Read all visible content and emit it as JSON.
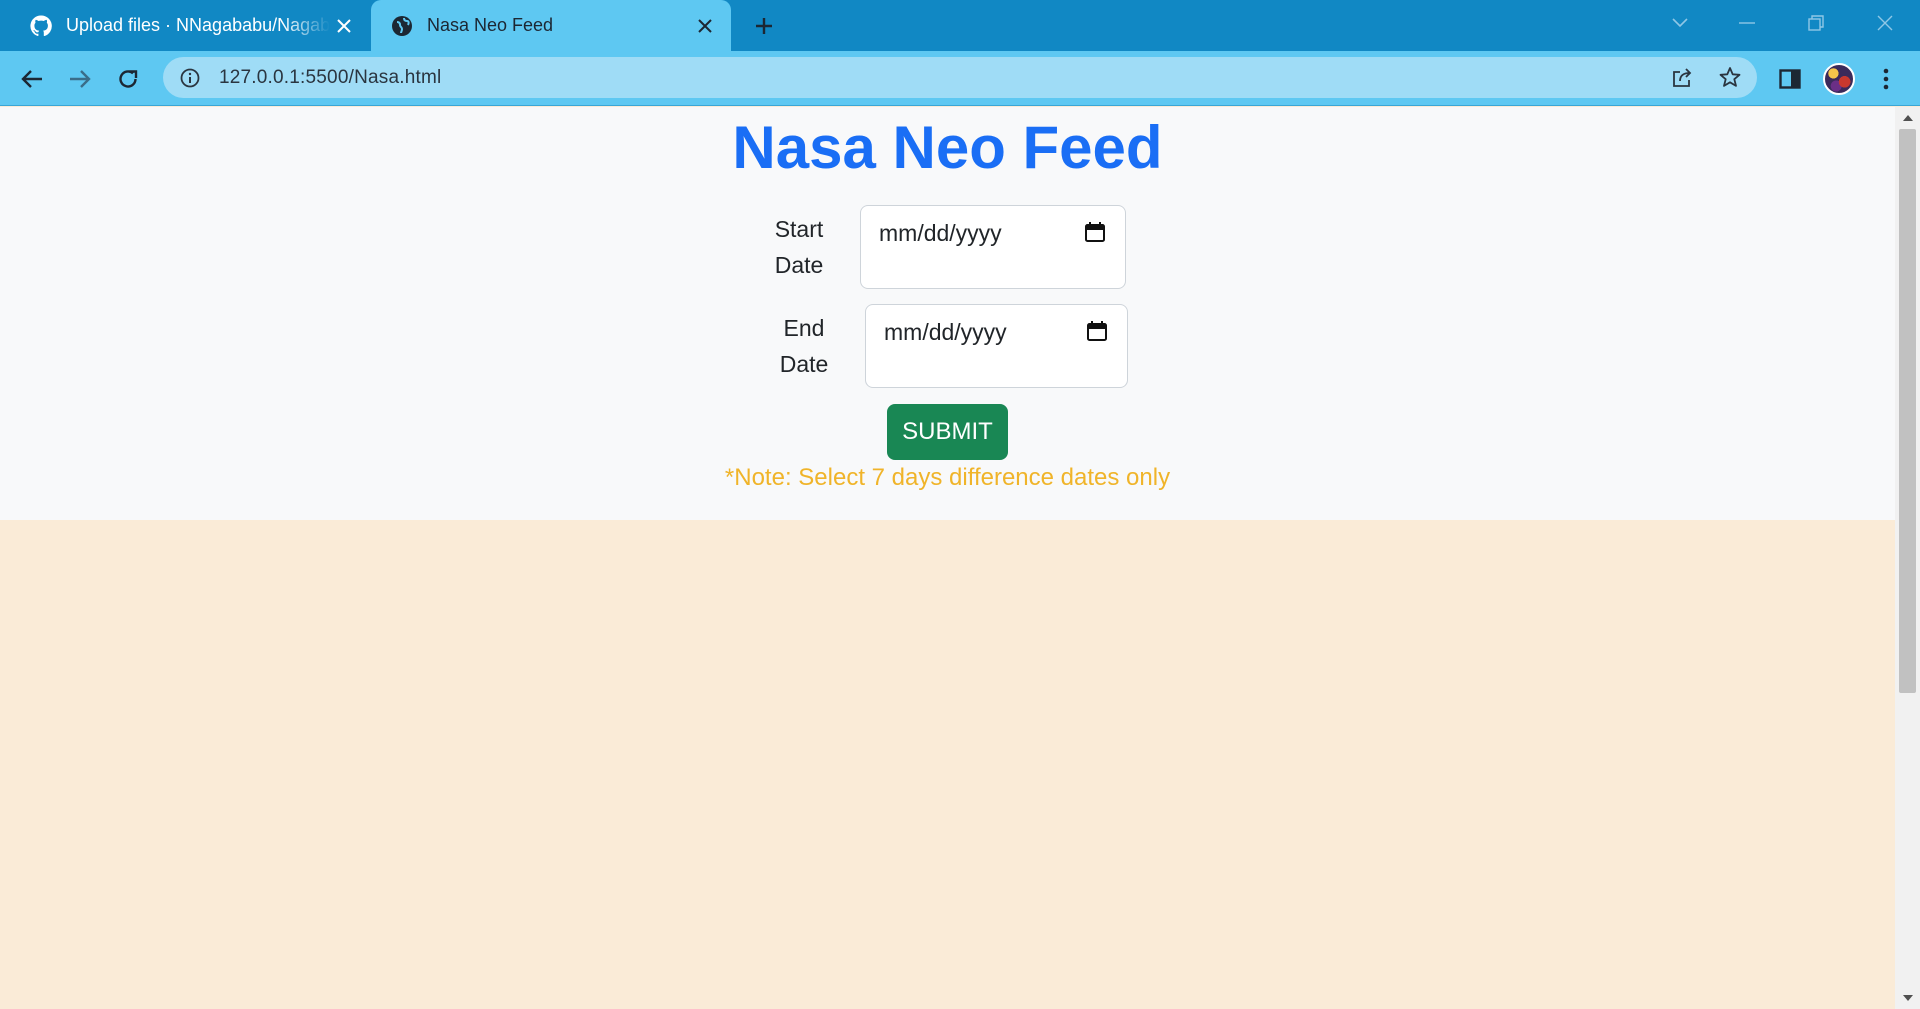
{
  "browser": {
    "tabs": [
      {
        "title": "Upload files · NNagababu/Nagababu",
        "icon": "github-icon"
      },
      {
        "title": "Nasa Neo Feed",
        "icon": "globe-icon"
      }
    ],
    "url": "127.0.0.1:5500/Nasa.html"
  },
  "page": {
    "title": "Nasa Neo Feed",
    "start_label": "Start Date",
    "start_placeholder": "mm/dd/yyyy",
    "end_label": "End Date",
    "end_placeholder": "mm/dd/yyyy",
    "submit_label": "SUBMIT",
    "note": "*Note: Select 7 days difference dates only"
  },
  "colors": {
    "title": "#1a6ef5",
    "submit_bg": "#198754",
    "note": "#f0b429",
    "results_bg": "#faebd7",
    "tab_strip": "#1188c4",
    "toolbar": "#5ec8f2"
  }
}
